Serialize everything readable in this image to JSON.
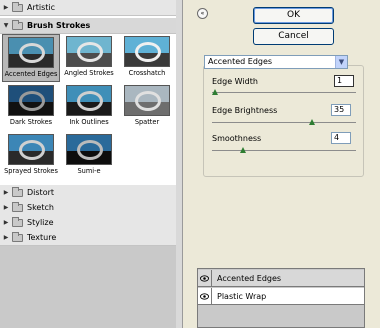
{
  "gallery": {
    "categories_top": [
      {
        "label": "Artistic",
        "open": false
      },
      {
        "label": "Brush Strokes",
        "open": true
      }
    ],
    "thumbnails": [
      {
        "label": "Accented Edges",
        "selected": true,
        "sky": "#4a8fb0",
        "ground": "#2a2a2a",
        "shape": "#d8d8d8"
      },
      {
        "label": "Angled Strokes",
        "selected": false,
        "sky": "#6fb5cf",
        "ground": "#4d4d4d",
        "shape": "#e6e6e6"
      },
      {
        "label": "Crosshatch",
        "selected": false,
        "sky": "#5fb1d6",
        "ground": "#3a3a3a",
        "shape": "#f0f0f0"
      },
      {
        "label": "Dark Strokes",
        "selected": false,
        "sky": "#1f4f7a",
        "ground": "#111111",
        "shape": "#9a9a9a"
      },
      {
        "label": "Ink Outlines",
        "selected": false,
        "sky": "#3f8fb8",
        "ground": "#1a1a1a",
        "shape": "#cfcfcf"
      },
      {
        "label": "Spatter",
        "selected": false,
        "sky": "#aab7c0",
        "ground": "#6e6e6e",
        "shape": "#e0e0e0"
      },
      {
        "label": "Sprayed Strokes",
        "selected": false,
        "sky": "#3c86b6",
        "ground": "#2a2a2a",
        "shape": "#d0d0d0"
      },
      {
        "label": "Sumi-e",
        "selected": false,
        "sky": "#2a6a9a",
        "ground": "#0d0d0d",
        "shape": "#bbbbbb"
      }
    ],
    "categories_bottom": [
      {
        "label": "Distort"
      },
      {
        "label": "Sketch"
      },
      {
        "label": "Stylize"
      },
      {
        "label": "Texture"
      }
    ]
  },
  "buttons": {
    "ok_label": "OK",
    "cancel_label": "Cancel",
    "collapse_glyph": "«"
  },
  "filter_select": {
    "value": "Accented Edges",
    "arrow": "▼"
  },
  "params": [
    {
      "label": "Edge Width",
      "value": "1",
      "focused": true,
      "level": 0.0
    },
    {
      "label": "Edge Brightness",
      "value": "35",
      "focused": false,
      "level": 0.7
    },
    {
      "label": "Smoothness",
      "value": "4",
      "focused": false,
      "level": 0.2
    }
  ],
  "layers": [
    {
      "label": "Accented Edges",
      "active": true
    },
    {
      "label": "Plastic Wrap",
      "active": false
    }
  ],
  "colors": {
    "slider_thumb": "#2e7d32",
    "button_border": "#003c74"
  }
}
